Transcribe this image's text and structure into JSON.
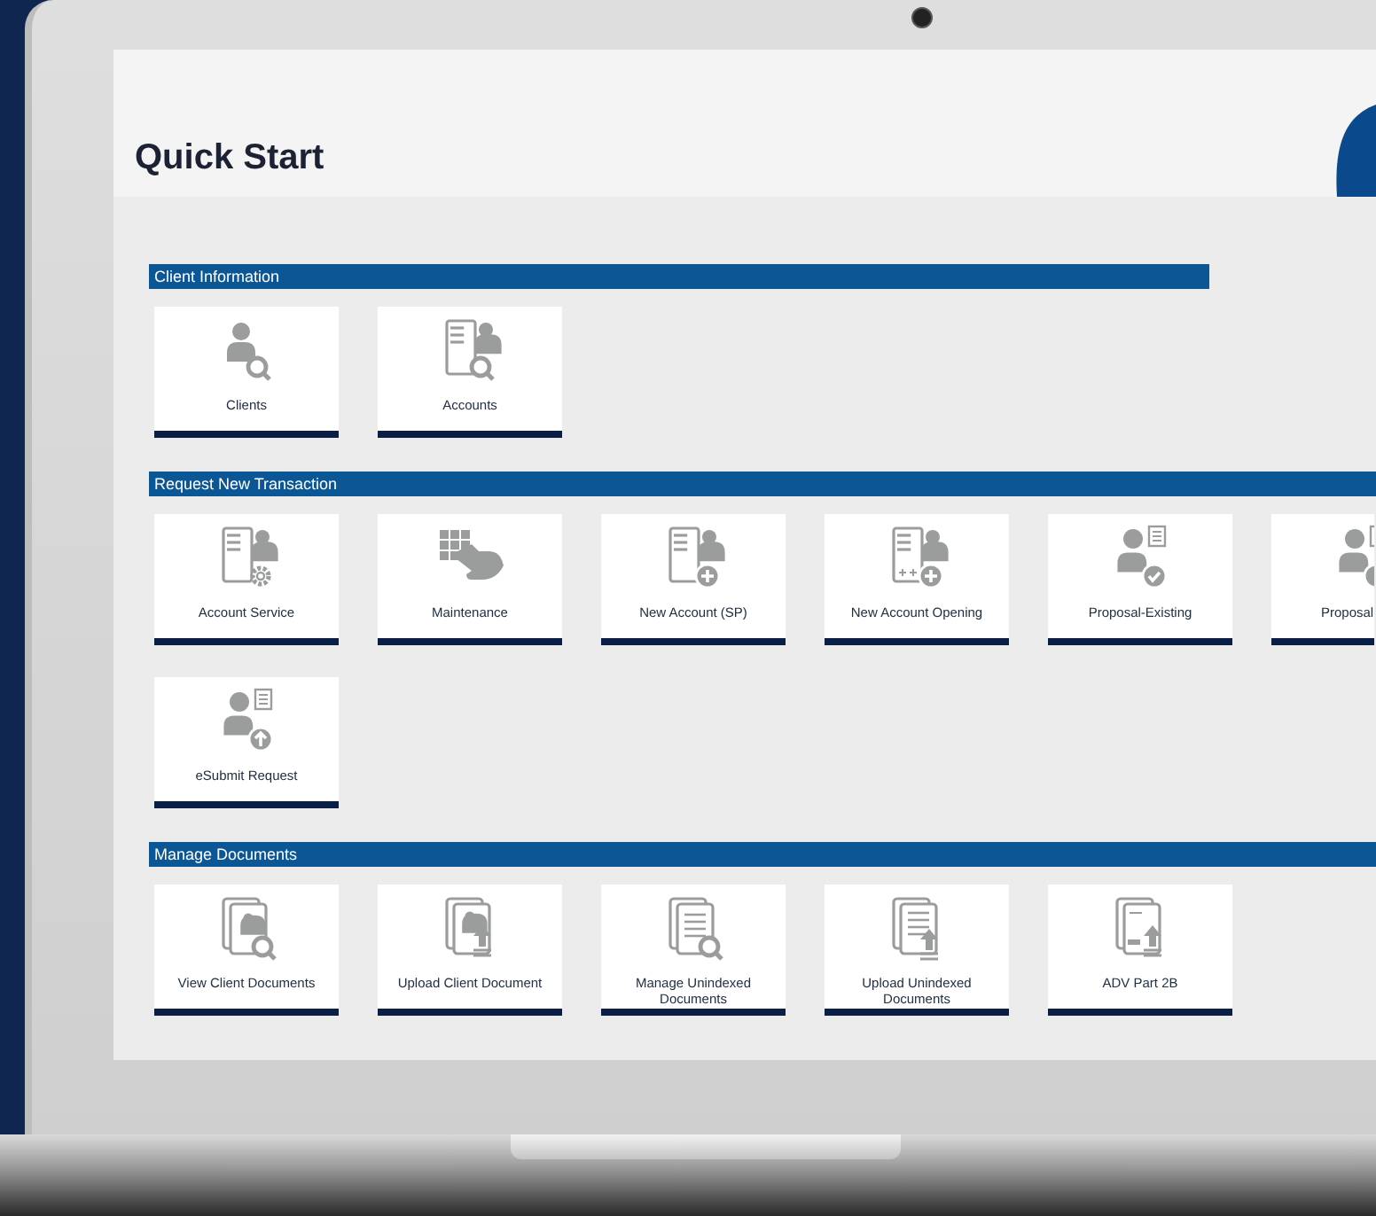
{
  "page": {
    "title": "Quick Start"
  },
  "sections": [
    {
      "title": "Client Information",
      "full_width": false,
      "tiles": [
        {
          "label": "Clients",
          "kind": "tile"
        },
        {
          "label": "Accounts",
          "kind": "tile"
        }
      ]
    },
    {
      "title": "Request New Transaction",
      "full_width": true,
      "tiles": [
        {
          "label": "Account Service",
          "kind": "tile"
        },
        {
          "label": "Maintenance",
          "kind": "tile"
        },
        {
          "label": "New Account (SP)",
          "kind": "tile"
        },
        {
          "label": "New Account Opening",
          "kind": "tile"
        },
        {
          "label": "Proposal-Existing",
          "kind": "tile"
        },
        {
          "label": "Proposal",
          "kind": "partial"
        },
        {
          "label": "eSubmit Request",
          "kind": "tile"
        }
      ]
    },
    {
      "title": "Manage Documents",
      "full_width": true,
      "tiles": [
        {
          "label": "View Client Documents",
          "kind": "tile"
        },
        {
          "label": "Upload Client Document",
          "kind": "tile"
        },
        {
          "label": "Manage Unindexed Documents",
          "kind": "tile"
        },
        {
          "label": "Upload Unindexed Documents",
          "kind": "tile"
        },
        {
          "label": "ADV Part 2B",
          "kind": "tile"
        }
      ]
    }
  ]
}
